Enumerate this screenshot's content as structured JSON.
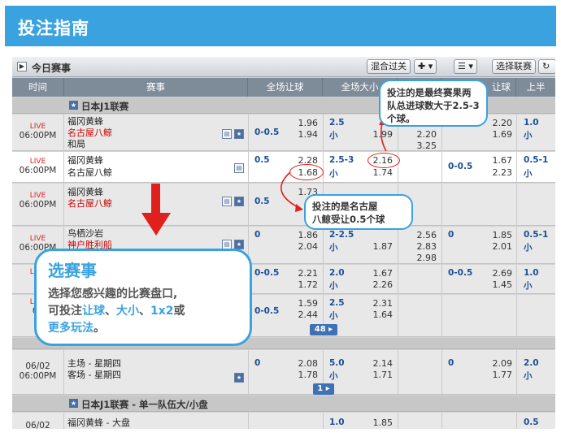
{
  "banner": {
    "title": "投注指南"
  },
  "topbar": {
    "title": "今日赛事",
    "collapse_label": "▶",
    "buttons": [
      "混合过关",
      "✚ ▾",
      "☰ ▾",
      "选择联赛"
    ]
  },
  "columns": [
    "时间",
    "赛事",
    "全场让球",
    "全场大小",
    "",
    "让球",
    "上半"
  ],
  "league1": {
    "name": "日本J1联赛"
  },
  "matches": [
    {
      "live": "LIVE",
      "time": "06:00PM",
      "teams": [
        "福冈黄蜂",
        "名古屋八鲸",
        "和局"
      ],
      "hdp_line": "0-0.5",
      "hdp_odds": [
        "1.96",
        "1.94"
      ],
      "ou_line": "2.5",
      "ou_under": "小",
      "ou_odds": [
        "",
        "1.99"
      ],
      "x12": [
        "",
        "2.20",
        "3.25"
      ],
      "h_odds": [
        "2.20",
        "1.69"
      ],
      "h_line": "1.0",
      "h_under": "小"
    },
    {
      "live": "LIVE",
      "time": "06:00PM",
      "teams": [
        "福冈黄蜂",
        "名古屋八鲸"
      ],
      "hdp_line": "0.5",
      "hdp_odds": [
        "2.28",
        "1.68"
      ],
      "ou_line": "2.5-3",
      "ou_under": "小",
      "ou_odds": [
        "2.16",
        "1.74"
      ],
      "h_hdp": "0-0.5",
      "h_odds": [
        "1.67",
        "2.23"
      ],
      "h_line": "0.5-1",
      "h_under": "小"
    },
    {
      "live": "LIVE",
      "time": "06:00PM",
      "teams": [
        "福冈黄蜂",
        "名古屋八鲸"
      ],
      "hdp_line": "0.5",
      "hdp_odds": [
        "1.73",
        ""
      ]
    },
    {
      "live": "LIVE",
      "time": "06:00PM",
      "teams": [
        "鸟栖沙岩",
        "神户胜利船"
      ],
      "hdp_line": "0",
      "hdp_odds": [
        "1.86",
        "2.04"
      ],
      "ou_line": "2-2.5",
      "ou_under": "小",
      "ou_odds": [
        "",
        "1.87"
      ],
      "x12": [
        "2.56",
        "2.83",
        "2.98"
      ],
      "h_hdp": "0",
      "h_odds": [
        "1.85",
        "2.01"
      ],
      "h_line": "0.5-1",
      "h_under": "小"
    },
    {
      "live": "LIVE",
      "time": "",
      "hdp_line": "0-0.5",
      "hdp_odds": [
        "2.21",
        "1.72"
      ],
      "ou_line": "2.0",
      "ou_under": "小",
      "ou_odds": [
        "1.67",
        "2.26"
      ],
      "h_hdp": "0-0.5",
      "h_odds": [
        "2.69",
        "1.45"
      ],
      "h_line": "1.0",
      "h_under": "小"
    },
    {
      "live": "LIVE",
      "time": "06",
      "hdp_line": "0-0.5",
      "hdp_odds": [
        "1.59",
        "2.44"
      ],
      "ou_line": "2.5",
      "ou_under": "小",
      "ou_odds": [
        "2.31",
        "1.64"
      ]
    }
  ],
  "pager1": "48 ▸",
  "special": {
    "date": "06/02",
    "time": "06:00PM",
    "teams": [
      "主场 - 星期四",
      "客场 - 星期四"
    ],
    "hdp_line": "0",
    "hdp_odds": [
      "2.08",
      "1.78"
    ],
    "ou_line": "5.0",
    "ou_under": "小",
    "ou_odds": [
      "2.14",
      "1.71"
    ],
    "h_hdp": "0",
    "h_odds": [
      "2.09",
      "1.77"
    ],
    "h_line": "2.0",
    "h_under": "小"
  },
  "pager2": "1 ▸",
  "league2": {
    "name": "日本J1联赛 - 单一队伍大/小盘"
  },
  "last": {
    "date": "06/02",
    "team": "福冈黄蜂 - 大盘",
    "ou_line": "1.0",
    "ou_odds": "1.85",
    "h_line": "0.5"
  },
  "callouts": {
    "top": "投注的是最终赛果两队总进球数大于2.5-3个球。",
    "mid_line1": "投注的是名古屋",
    "mid_line2": "八鲸受让0.5个球",
    "big_title": "选赛事",
    "big_line1": "选择您感兴趣的比赛盘口,",
    "big_line2_a": "可投注",
    "big_line2_b": "让球",
    "big_line2_c": "、",
    "big_line2_d": "大小",
    "big_line2_e": "、",
    "big_line2_f": "1x2",
    "big_line2_g": "或",
    "big_line3": "更多玩法",
    "big_line3_end": "。"
  },
  "colors": {
    "accent": "#3aa2df",
    "header": "#7e8b99",
    "live": "#dd2222",
    "arrow": "#e0201c"
  }
}
